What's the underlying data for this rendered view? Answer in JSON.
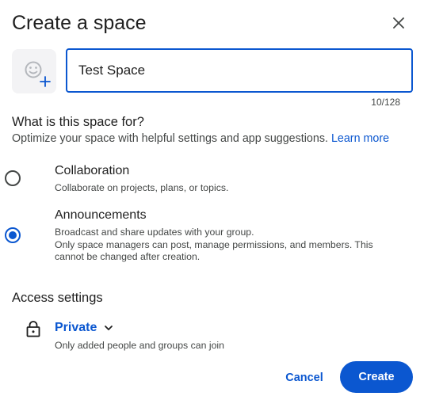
{
  "dialog": {
    "title": "Create a space",
    "close_icon": "close-icon"
  },
  "name_field": {
    "value": "Test Space",
    "counter": "10/128",
    "emoji_icon": "add-emoji-icon"
  },
  "purpose": {
    "heading": "What is this space for?",
    "subtitle": "Optimize your space with helpful settings and app suggestions.",
    "learn_more": "Learn more",
    "options": [
      {
        "label": "Collaboration",
        "description": "Collaborate on projects, plans, or topics.",
        "selected": false
      },
      {
        "label": "Announcements",
        "description": "Broadcast and share updates with your group.\nOnly space managers can post, manage permissions, and members. This cannot be changed after creation.",
        "description_line1": "Broadcast and share updates with your group.",
        "description_line2": "Only space managers can post, manage permissions, and members. This cannot be changed after creation.",
        "selected": true
      }
    ]
  },
  "access": {
    "heading": "Access settings",
    "value": "Private",
    "description": "Only added people and groups can join",
    "icon": "lock-icon"
  },
  "actions": {
    "cancel_label": "Cancel",
    "create_label": "Create"
  },
  "colors": {
    "accent": "#0b57d0",
    "text": "#1f1f1f",
    "secondary_text": "#444746"
  }
}
